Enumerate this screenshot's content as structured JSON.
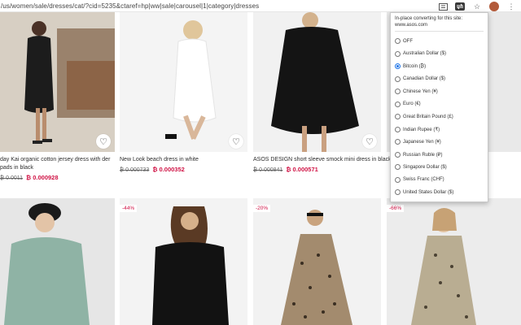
{
  "browser": {
    "url": "/us/women/sale/dresses/cat/?cid=5235&ctaref=hp|ww|sale|carousel|1|category|dresses"
  },
  "products": [
    {
      "name": "day Kai organic cotton jersey dress with der pads in black",
      "old_price": "₿ 0.0011",
      "new_price": "₿ 0.000928"
    },
    {
      "name": "New Look beach dress in white",
      "old_price": "₿ 0.000733",
      "new_price": "₿ 0.000352"
    },
    {
      "name": "ASOS DESIGN short sleeve smock mini dress in black",
      "old_price": "₿ 0.000841",
      "new_price": "₿ 0.000571"
    }
  ],
  "badges": {
    "tile2": "-44%",
    "tile3": "-20%",
    "tile4": "-66%"
  },
  "popup": {
    "header": "In-place converting for this site:",
    "site": "www.asos.com",
    "selected_index": 2,
    "options": [
      "OFF",
      "Australian Dollar ($)",
      "Bitcoin (₿)",
      "Canadian Dollar ($)",
      "Chinese Yen (¥)",
      "Euro (€)",
      "Great Britain Pound (£)",
      "Indian Rupee (₹)",
      "Japanese Yen (¥)",
      "Russian Ruble (₽)",
      "Singapore Dollar ($)",
      "Swiss Franc (CHF)",
      "United States Dollar ($)"
    ]
  },
  "colors": {
    "accent": "#d01345",
    "radio_selected": "#1a73e8"
  }
}
